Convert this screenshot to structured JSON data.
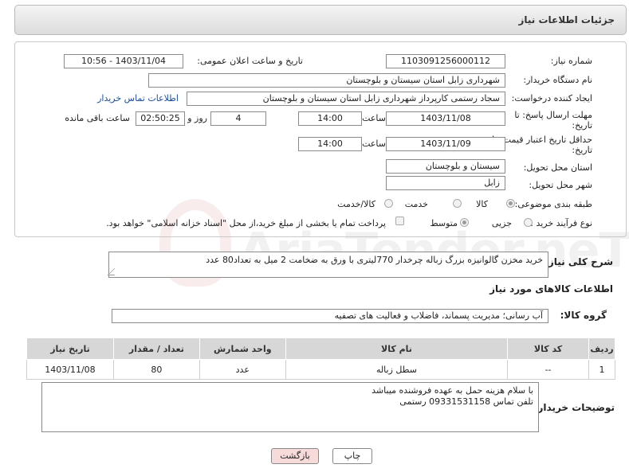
{
  "header": {
    "title": "جزئیات اطلاعات نیاز"
  },
  "fields": {
    "need_number_label": "شماره نیاز:",
    "need_number": "1103091256000112",
    "announce_label": "تاریخ و ساعت اعلان عمومی:",
    "announce_value": "1403/11/04 - 10:56",
    "buyer_org_label": "نام دستگاه خریدار:",
    "buyer_org": "شهرداری زابل استان سیستان و بلوچستان",
    "requester_label": "ایجاد کننده درخواست:",
    "requester": "سجاد رستمی کارپرداز شهرداری زابل استان سیستان و بلوچستان",
    "buyer_contact_link": "اطلاعات تماس خریدار",
    "deadline_label_1": "مهلت ارسال پاسخ: تا",
    "deadline_label_2": "تاریخ:",
    "deadline_date": "1403/11/08",
    "time_label": "ساعت",
    "deadline_time": "14:00",
    "days_count": "4",
    "days_label": "روز و",
    "remaining_time": "02:50:25",
    "remaining_label": "ساعت باقی مانده",
    "price_valid_label_1": "حداقل تاریخ اعتبار قیمت: تا",
    "price_valid_label_2": "تاریخ:",
    "price_valid_date": "1403/11/09",
    "price_valid_time": "14:00",
    "province_label": "استان محل تحویل:",
    "province": "سیستان و بلوچستان",
    "city_label": "شهر محل تحویل:",
    "city": "زابل",
    "category_label": "طبقه بندی موضوعی:",
    "category_options": [
      "کالا",
      "خدمت",
      "کالا/خدمت"
    ],
    "process_label": "نوع فرآیند خرید :",
    "process_options": [
      "جزیی",
      "متوسط"
    ],
    "treasury_note": "پرداخت تمام یا بخشی از مبلغ خرید،از محل \"اسناد خزانه اسلامی\" خواهد بود."
  },
  "summary": {
    "label": "شرح کلی نیاز:",
    "text": "خرید مخزن گالوانیزه  بزرگ زباله چرخدار  770لیتری با ورق به ضخامت 2  میل به تعداد80 عدد"
  },
  "goods_section_title": "اطلاعات کالاهای مورد نیاز",
  "goods_group": {
    "label": "گروه کالا:",
    "value": "آب رسانی؛ مدیریت پسماند، فاضلاب و فعالیت های تصفیه"
  },
  "table": {
    "headers": [
      "ردیف",
      "کد کالا",
      "نام کالا",
      "واحد شمارش",
      "تعداد / مقدار",
      "تاریخ نیاز"
    ],
    "rows": [
      [
        "1",
        "--",
        "سطل زباله",
        "عدد",
        "80",
        "1403/11/08"
      ]
    ]
  },
  "buyer_notes": {
    "label": "توضیحات خریدار:",
    "line1": "با سلام هزینه حمل به عهده فروشنده میباشد",
    "line2": "تلفن تماس 09331531158 رستمی"
  },
  "buttons": {
    "print": "چاپ",
    "back": "بازگشت"
  },
  "watermark": "AriaTender.neT",
  "colors": {
    "link": "#1a4fa3",
    "back_button": "#f7dada",
    "table_header": "#d7d7d7"
  }
}
